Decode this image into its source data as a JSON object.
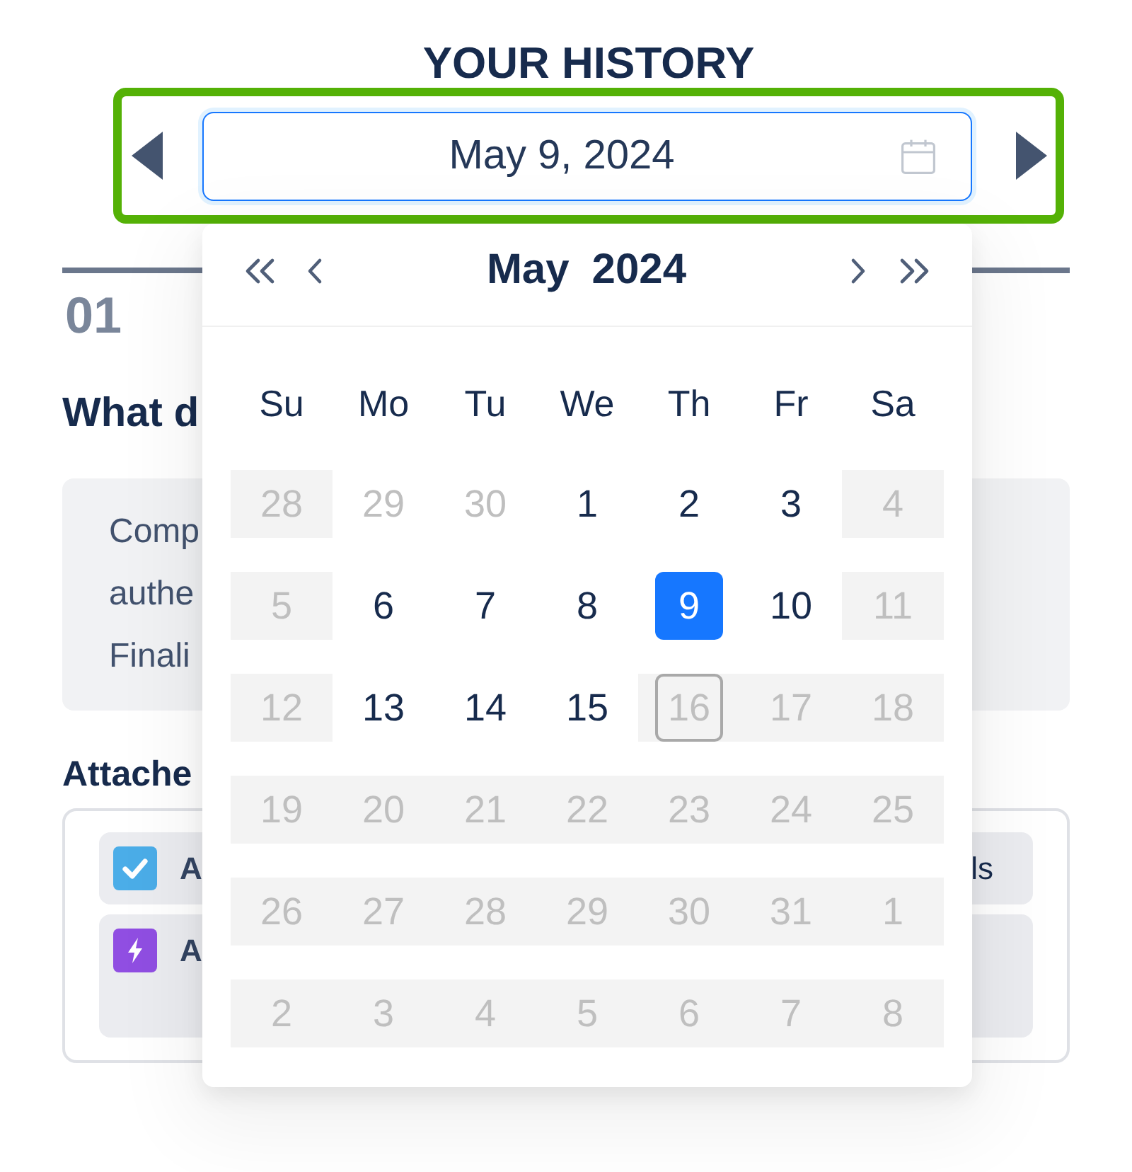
{
  "title": "YOUR HISTORY",
  "date_picker": {
    "value": "May 9, 2024",
    "focused": true
  },
  "calendar": {
    "month": "May",
    "year": "2024",
    "weekdays": [
      "Su",
      "Mo",
      "Tu",
      "We",
      "Th",
      "Fr",
      "Sa"
    ],
    "weeks": [
      {
        "days": [
          {
            "day": "28",
            "kind": "disabled",
            "selected": false,
            "today": false
          },
          {
            "day": "29",
            "kind": "outside",
            "selected": false,
            "today": false
          },
          {
            "day": "30",
            "kind": "outside",
            "selected": false,
            "today": false
          },
          {
            "day": "1",
            "kind": "normal",
            "selected": false,
            "today": false
          },
          {
            "day": "2",
            "kind": "normal",
            "selected": false,
            "today": false
          },
          {
            "day": "3",
            "kind": "normal",
            "selected": false,
            "today": false
          },
          {
            "day": "4",
            "kind": "disabled",
            "selected": false,
            "today": false
          }
        ]
      },
      {
        "days": [
          {
            "day": "5",
            "kind": "disabled",
            "selected": false,
            "today": false
          },
          {
            "day": "6",
            "kind": "normal",
            "selected": false,
            "today": false
          },
          {
            "day": "7",
            "kind": "normal",
            "selected": false,
            "today": false
          },
          {
            "day": "8",
            "kind": "normal",
            "selected": false,
            "today": false
          },
          {
            "day": "9",
            "kind": "normal",
            "selected": true,
            "today": false
          },
          {
            "day": "10",
            "kind": "normal",
            "selected": false,
            "today": false
          },
          {
            "day": "11",
            "kind": "disabled",
            "selected": false,
            "today": false
          }
        ]
      },
      {
        "days": [
          {
            "day": "12",
            "kind": "disabled",
            "selected": false,
            "today": false
          },
          {
            "day": "13",
            "kind": "normal",
            "selected": false,
            "today": false
          },
          {
            "day": "14",
            "kind": "normal",
            "selected": false,
            "today": false
          },
          {
            "day": "15",
            "kind": "normal",
            "selected": false,
            "today": false
          },
          {
            "day": "16",
            "kind": "disabled",
            "selected": false,
            "today": true
          },
          {
            "day": "17",
            "kind": "disabled",
            "selected": false,
            "today": false
          },
          {
            "day": "18",
            "kind": "disabled",
            "selected": false,
            "today": false
          }
        ]
      },
      {
        "days": [
          {
            "day": "19",
            "kind": "disabled",
            "selected": false,
            "today": false
          },
          {
            "day": "20",
            "kind": "disabled",
            "selected": false,
            "today": false
          },
          {
            "day": "21",
            "kind": "disabled",
            "selected": false,
            "today": false
          },
          {
            "day": "22",
            "kind": "disabled",
            "selected": false,
            "today": false
          },
          {
            "day": "23",
            "kind": "disabled",
            "selected": false,
            "today": false
          },
          {
            "day": "24",
            "kind": "disabled",
            "selected": false,
            "today": false
          },
          {
            "day": "25",
            "kind": "disabled",
            "selected": false,
            "today": false
          }
        ]
      },
      {
        "days": [
          {
            "day": "26",
            "kind": "disabled",
            "selected": false,
            "today": false
          },
          {
            "day": "27",
            "kind": "disabled",
            "selected": false,
            "today": false
          },
          {
            "day": "28",
            "kind": "disabled",
            "selected": false,
            "today": false
          },
          {
            "day": "29",
            "kind": "disabled",
            "selected": false,
            "today": false
          },
          {
            "day": "30",
            "kind": "disabled",
            "selected": false,
            "today": false
          },
          {
            "day": "31",
            "kind": "disabled",
            "selected": false,
            "today": false
          },
          {
            "day": "1",
            "kind": "disabled",
            "selected": false,
            "today": false
          }
        ]
      },
      {
        "days": [
          {
            "day": "2",
            "kind": "disabled",
            "selected": false,
            "today": false
          },
          {
            "day": "3",
            "kind": "disabled",
            "selected": false,
            "today": false
          },
          {
            "day": "4",
            "kind": "disabled",
            "selected": false,
            "today": false
          },
          {
            "day": "5",
            "kind": "disabled",
            "selected": false,
            "today": false
          },
          {
            "day": "6",
            "kind": "disabled",
            "selected": false,
            "today": false
          },
          {
            "day": "7",
            "kind": "disabled",
            "selected": false,
            "today": false
          },
          {
            "day": "8",
            "kind": "disabled",
            "selected": false,
            "today": false
          }
        ]
      }
    ]
  },
  "section": {
    "number": "01",
    "question": "What d",
    "description_lines": [
      "Comp",
      "authe",
      "Finali"
    ],
    "attachments_label": "Attache",
    "attachments": [
      {
        "kind": "check",
        "title": "A",
        "trailing": "ls"
      },
      {
        "kind": "bolt",
        "title": "A"
      }
    ]
  }
}
